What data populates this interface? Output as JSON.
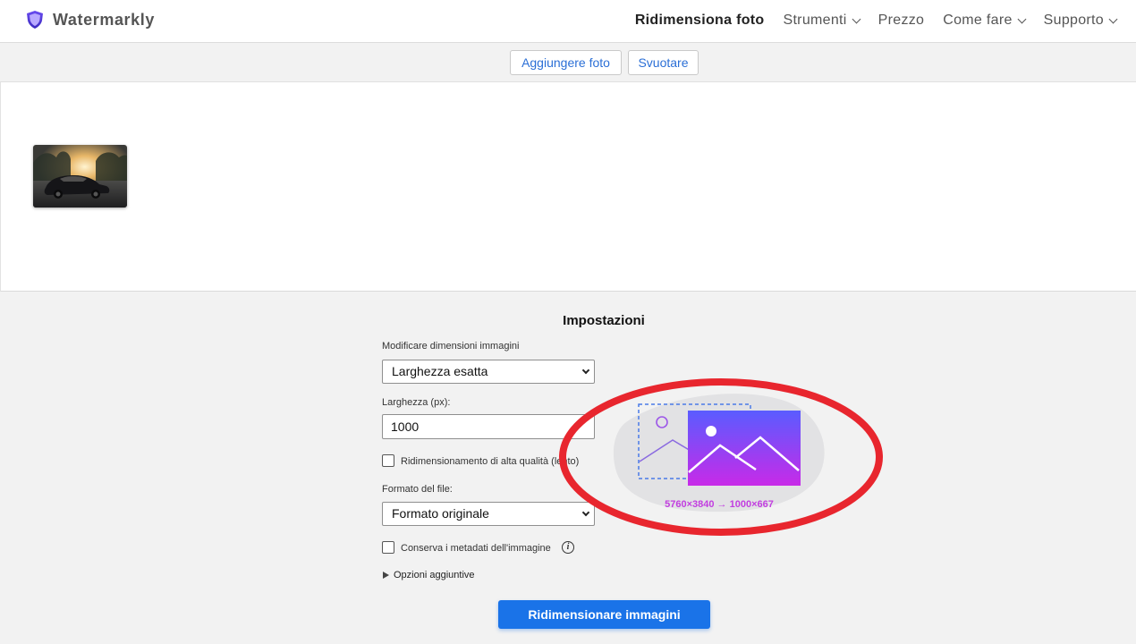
{
  "brand": {
    "name": "Watermarkly"
  },
  "nav": {
    "resize": "Ridimensiona foto",
    "tools": "Strumenti",
    "price": "Prezzo",
    "howto": "Come fare",
    "support": "Supporto"
  },
  "toolbar": {
    "add_label": "Aggiungere foto",
    "clear_label": "Svuotare"
  },
  "settings": {
    "title": "Impostazioni",
    "resize_mode_label": "Modificare dimensioni immagini",
    "resize_mode_value": "Larghezza esatta",
    "width_label": "Larghezza (px):",
    "width_value": "1000",
    "hq_label": "Ridimensionamento di alta qualità (lento)",
    "hq_checked": false,
    "format_label": "Formato del file:",
    "format_value": "Formato originale",
    "metadata_label": "Conserva i metadati dell'immagine",
    "metadata_checked": false,
    "more_options": "Opzioni aggiuntive",
    "submit_label": "Ridimensionare immagini"
  },
  "preview": {
    "dimensions": "5760×3840 → 1000×667"
  },
  "colors": {
    "accent": "#1a73e8",
    "link": "#2b6fd6",
    "annotation": "#e8262e",
    "gradient_start": "#5a5cff",
    "gradient_end": "#c82ae8"
  }
}
